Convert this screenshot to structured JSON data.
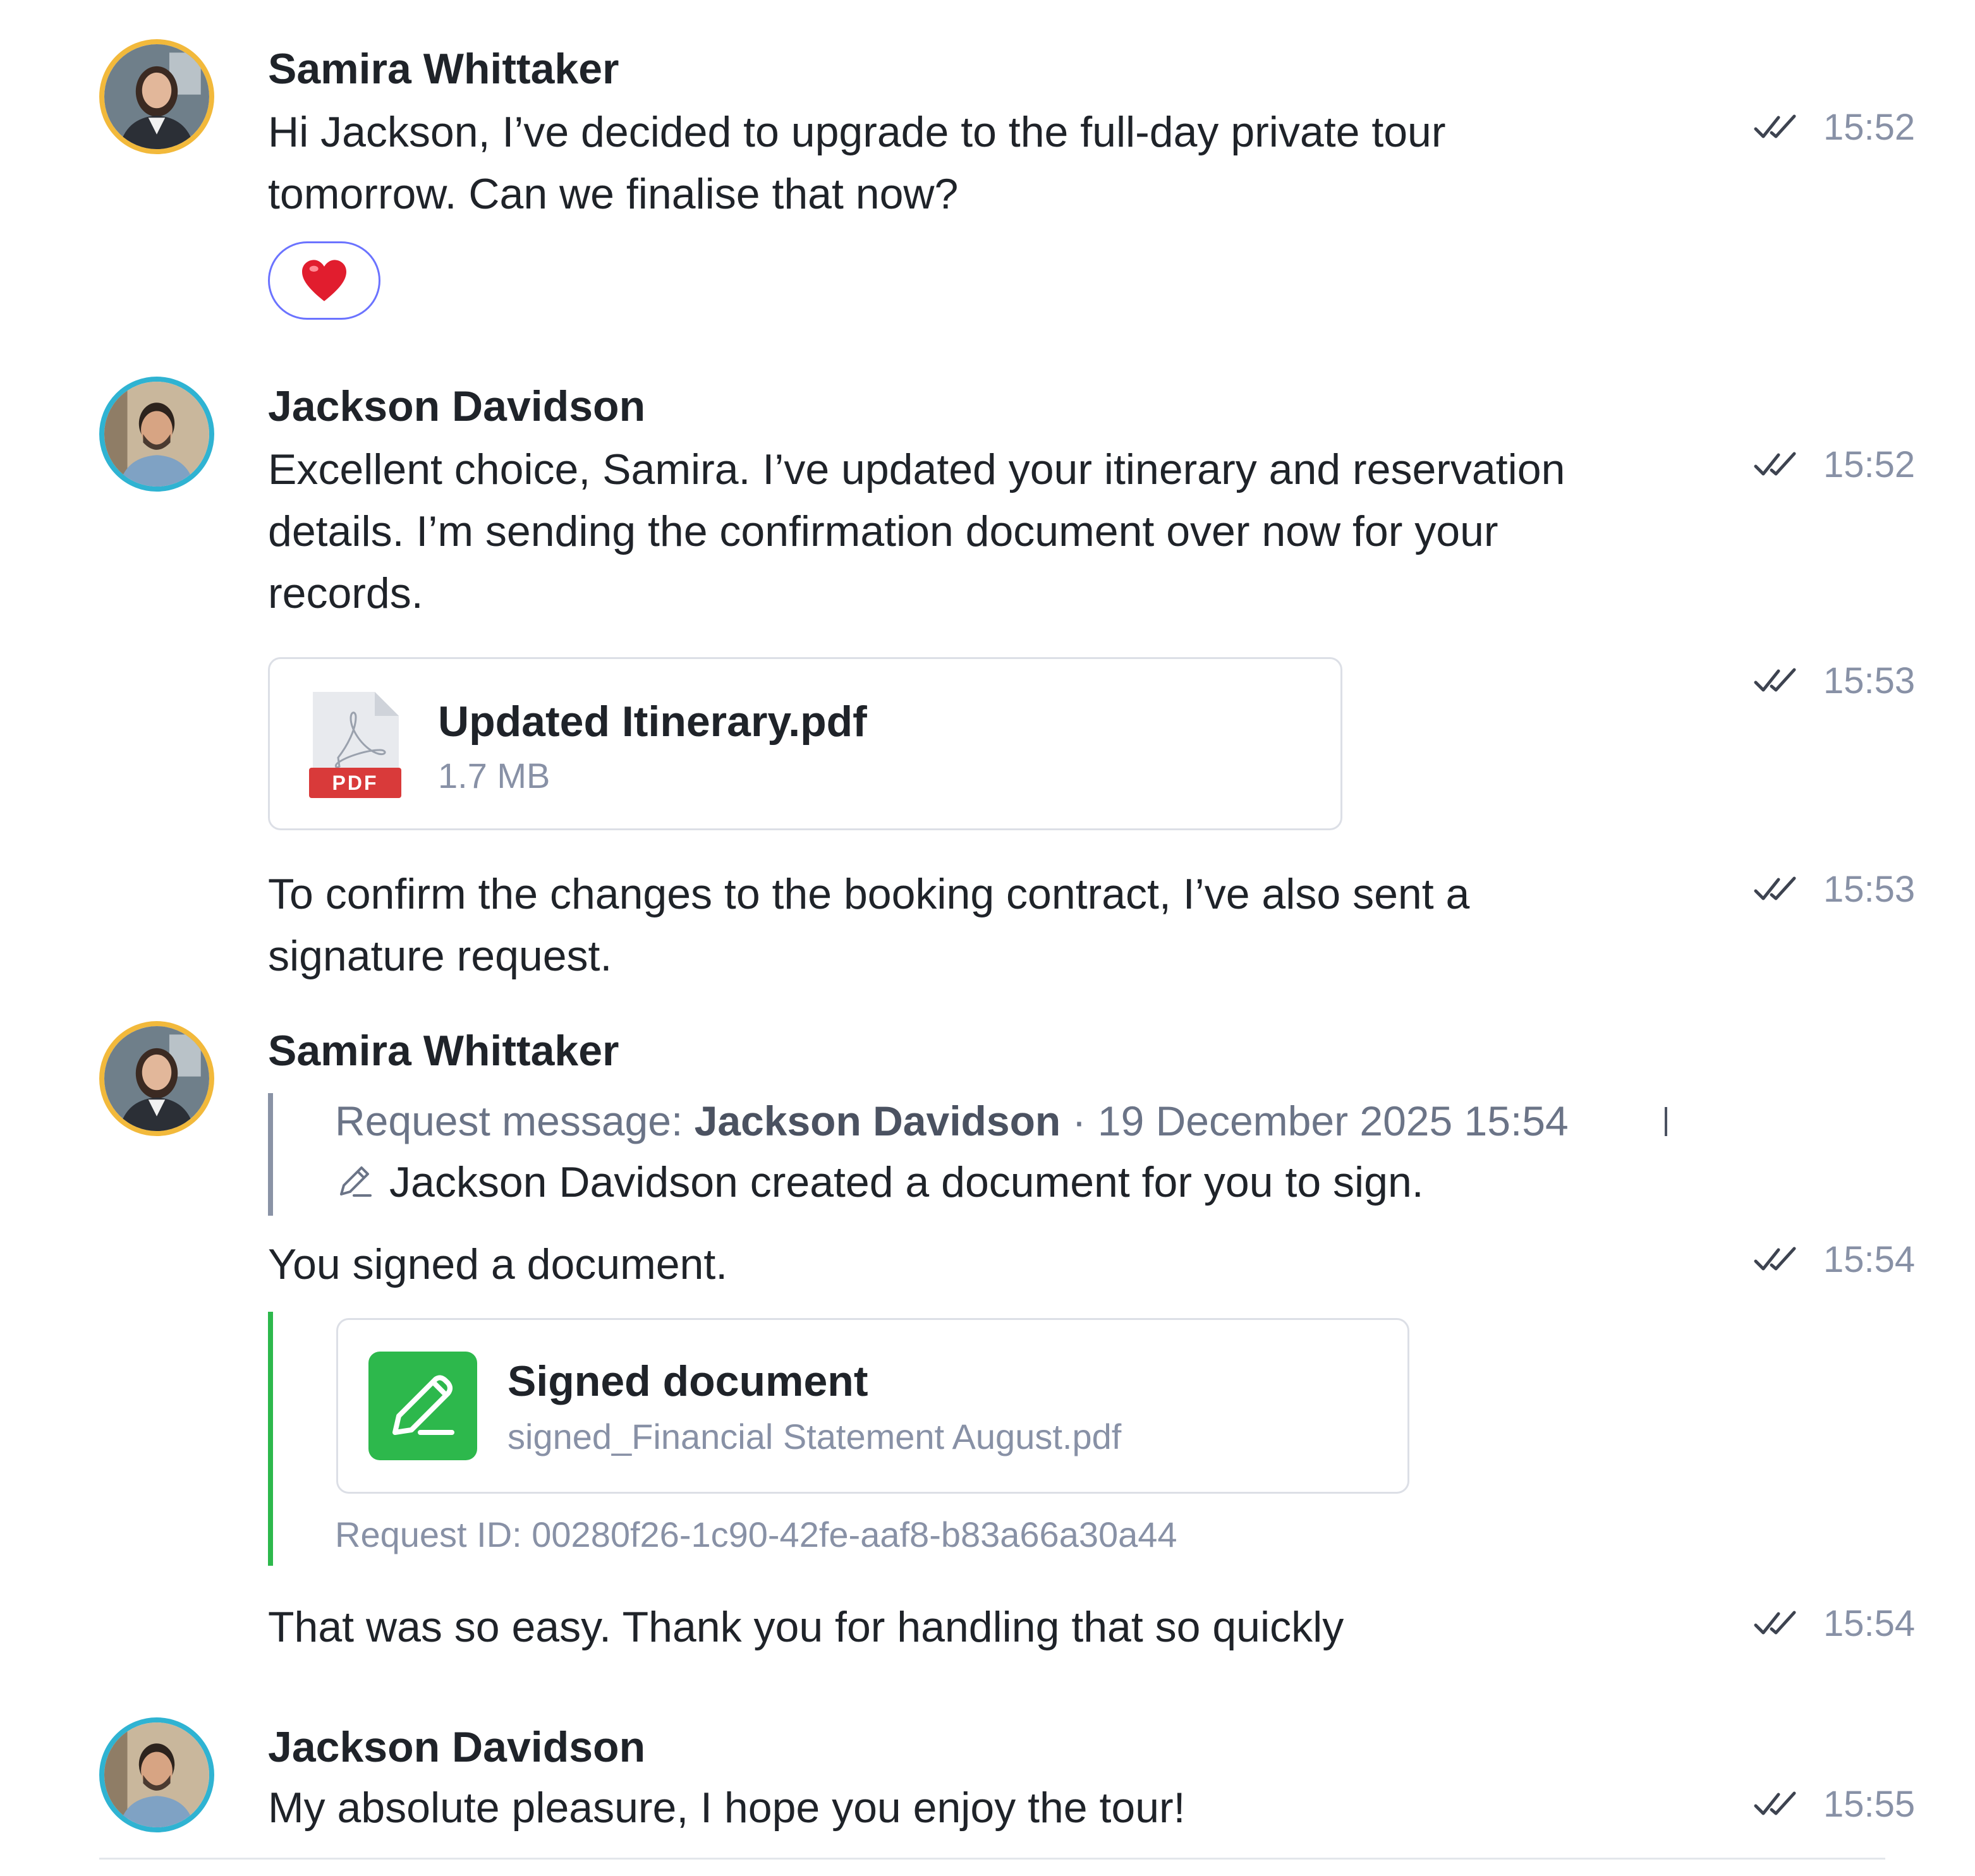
{
  "messages": {
    "m1": {
      "sender": "Samira Whittaker",
      "line1": "Hi Jackson, I’ve decided to upgrade to the full-day private tour",
      "line2": "tomorrow. Can we finalise that now?",
      "reaction": "❤️",
      "time": "15:52"
    },
    "m2": {
      "sender": "Jackson Davidson",
      "line1": "Excellent choice, Samira. I’ve updated your itinerary and reservation",
      "line2": "details. I’m sending the confirmation document over now for your",
      "line3": "records.",
      "time": "15:52"
    },
    "m3": {
      "file_name": "Updated Itinerary.pdf",
      "file_size": "1.7 MB",
      "file_badge": "PDF",
      "time": "15:53"
    },
    "m4": {
      "line1": "To confirm the changes to the booking contract, I’ve also sent a",
      "line2": "signature request.",
      "time": "15:53"
    },
    "m5": {
      "sender": "Samira Whittaker",
      "quote_prefix": "Request message: ",
      "quote_author": "Jackson Davidson",
      "quote_separator": " · ",
      "quote_date": "19 December 2025 15:54",
      "quote_text": "Jackson Davidson created a document for you to sign.",
      "text": "You signed a document.",
      "card_title": "Signed document",
      "card_file": "signed_Financial Statement August.pdf",
      "request_id": "Request ID: 00280f26-1c90-42fe-aaf8-b83a66a30a44",
      "time": "15:54"
    },
    "m6": {
      "text": "That was so easy. Thank you for handling that so quickly",
      "time": "15:54"
    },
    "m7": {
      "sender": "Jackson Davidson",
      "text": "My absolute pleasure, I hope you enjoy the tour!",
      "time": "15:55"
    }
  },
  "icons": {
    "read_status": "double-check-icon",
    "pdf": "pdf-file-icon",
    "pen": "pen-icon",
    "signed": "signature-icon"
  },
  "colors": {
    "samira_ring": "#f2b93b",
    "jackson_ring": "#2fb3d2",
    "reaction_border": "#6b73ff",
    "signed_green": "#2db84c",
    "pdf_red": "#d93a3a"
  }
}
